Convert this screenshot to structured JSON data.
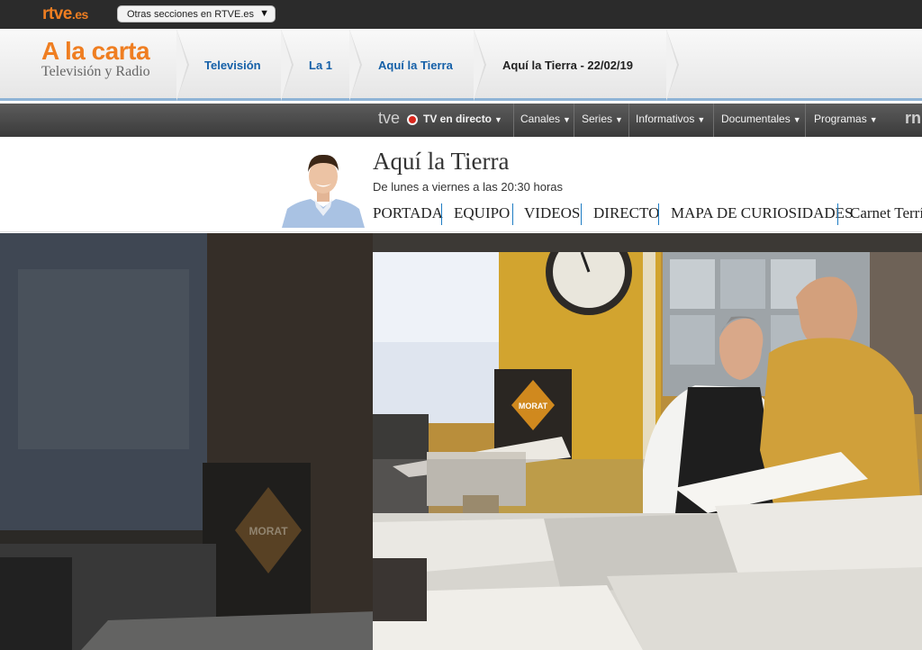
{
  "topbar": {
    "logo_main": "rtve",
    "logo_suffix": ".es",
    "sections_label": "Otras secciones en RTVE.es"
  },
  "header": {
    "brand_title": "A la carta",
    "brand_subtitle": "Televisión y Radio"
  },
  "breadcrumb": [
    {
      "label": "Televisión"
    },
    {
      "label": "La 1"
    },
    {
      "label": "Aquí la Tierra"
    },
    {
      "label": "Aquí la Tierra - 22/02/19"
    }
  ],
  "nav": {
    "brand": "tve",
    "items": [
      {
        "label": "TV en directo"
      },
      {
        "label": "Canales"
      },
      {
        "label": "Series"
      },
      {
        "label": "Informativos"
      },
      {
        "label": "Documentales"
      },
      {
        "label": "Programas"
      }
    ],
    "more": "rn"
  },
  "program": {
    "title": "Aquí la Tierra",
    "schedule": "De lunes a viernes a las 20:30 horas",
    "tabs": [
      {
        "label": "PORTADA"
      },
      {
        "label": "EQUIPO"
      },
      {
        "label": "VIDEOS"
      },
      {
        "label": "DIRECTO"
      },
      {
        "label": "MAPA DE CURIOSIDADES"
      },
      {
        "label": "Carnet Terrí"
      }
    ]
  },
  "hero": {
    "shop_sign": "MORAT"
  },
  "colors": {
    "brand_orange": "#ef7e21",
    "link_blue": "#1560a8",
    "live_red": "#d9261c",
    "tab_separator": "#1e7cc3"
  }
}
